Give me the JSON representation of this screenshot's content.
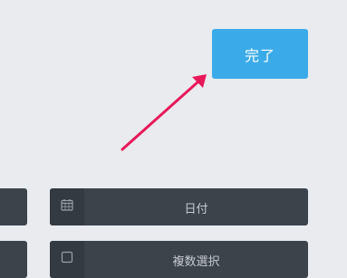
{
  "done_button": {
    "label": "完了"
  },
  "fields": [
    {
      "label": "日付",
      "icon": "calendar-icon"
    },
    {
      "label": "複数選択",
      "icon": "checkbox-icon"
    }
  ],
  "colors": {
    "background": "#e9ebee",
    "accent": "#3aabe8",
    "field": "#3c434b",
    "arrow": "#e8185a"
  }
}
